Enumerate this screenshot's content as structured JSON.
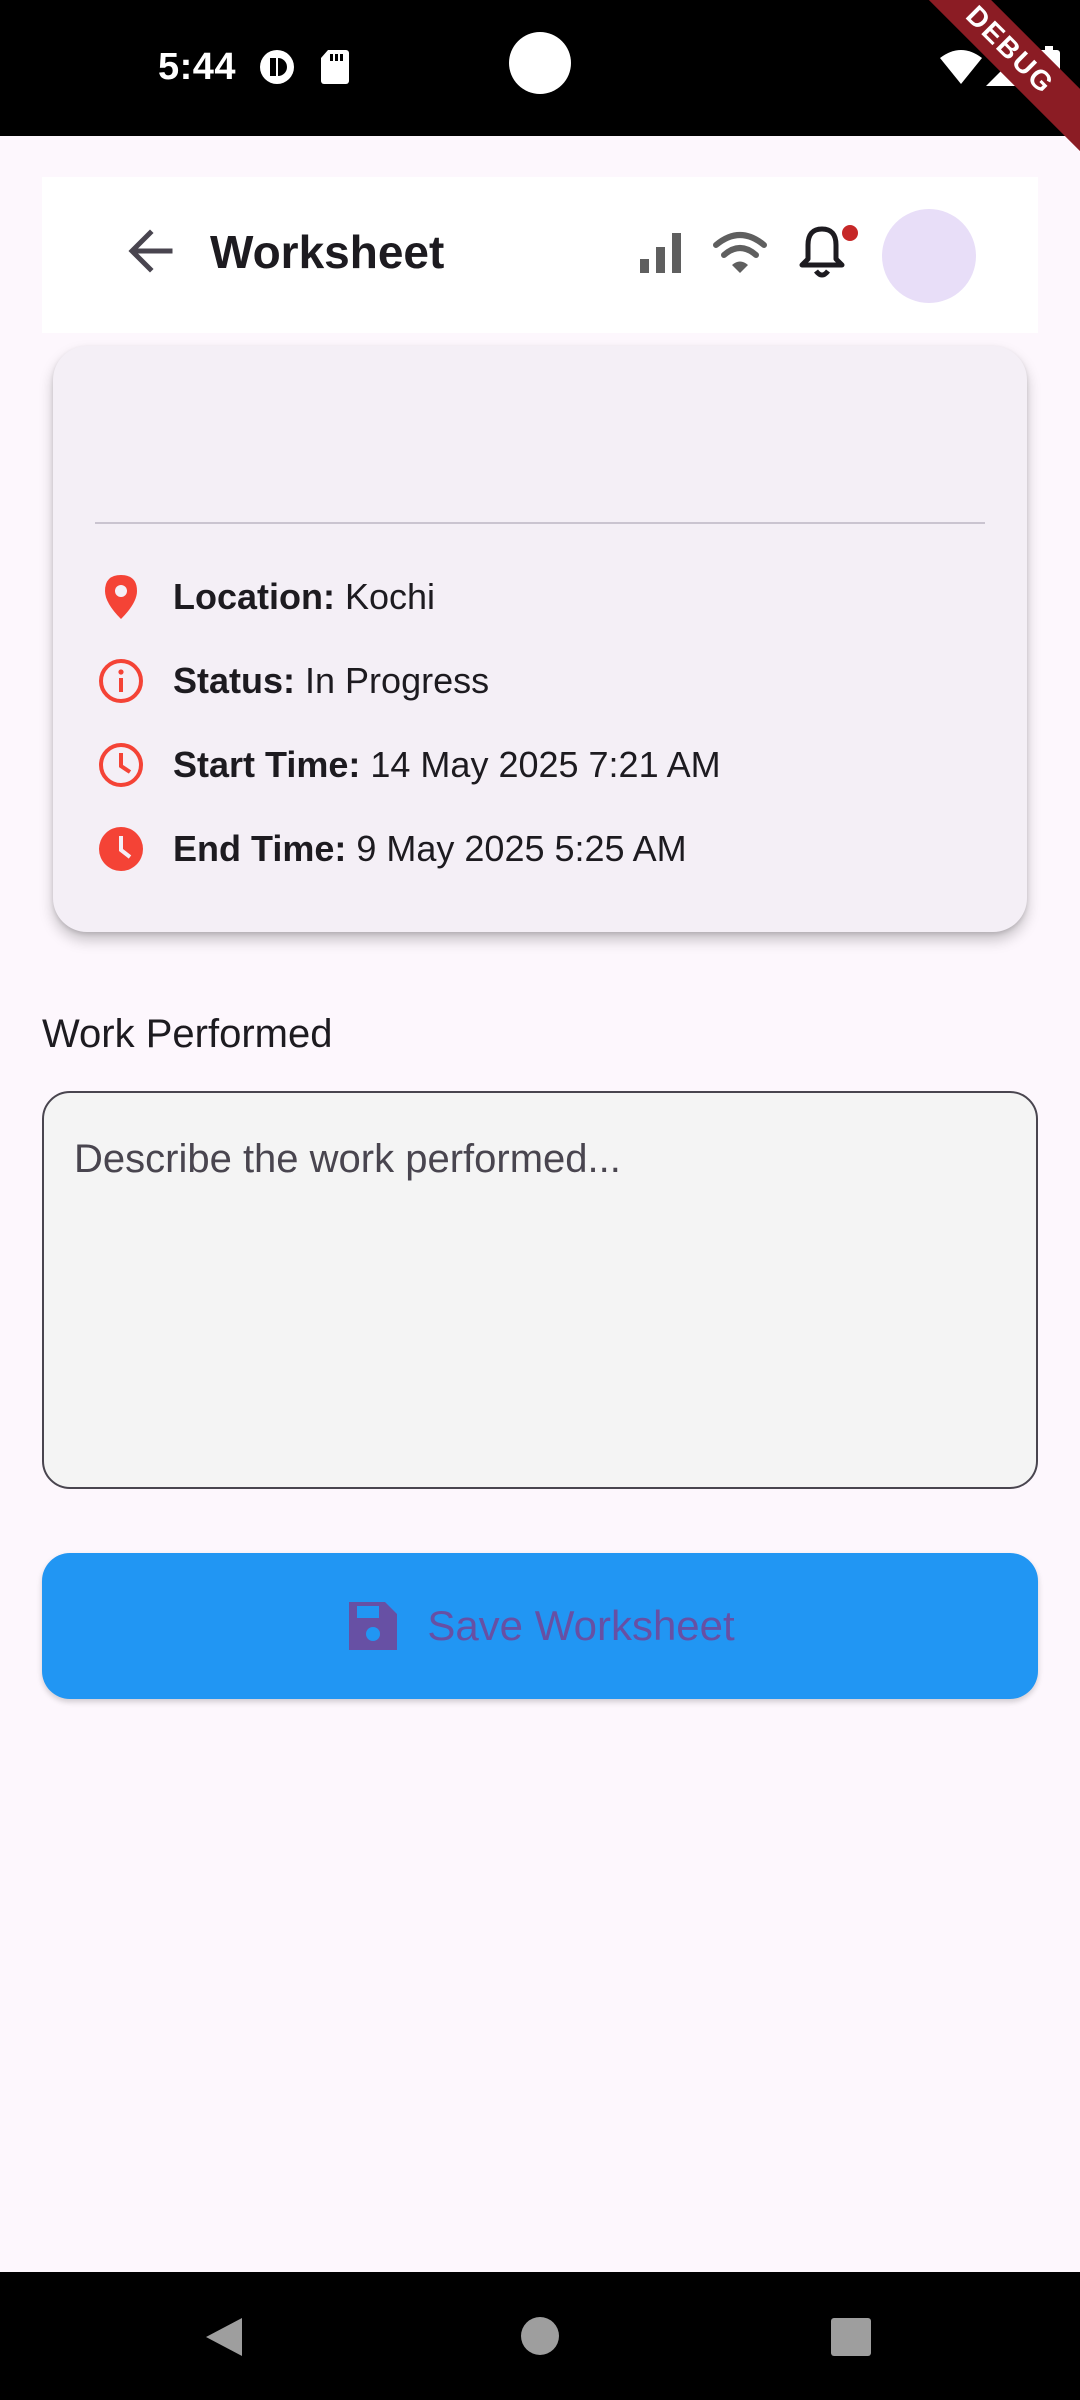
{
  "status_bar": {
    "time": "5:44",
    "debug_label": "DEBUG"
  },
  "app_bar": {
    "title": "Worksheet",
    "notification_dot_color": "#c62828",
    "avatar_color": "#e8def8"
  },
  "info_card": {
    "rows": [
      {
        "icon": "location-pin-icon",
        "label": "Location:",
        "value": "Kochi"
      },
      {
        "icon": "info-icon",
        "label": "Status:",
        "value": "In Progress"
      },
      {
        "icon": "clock-outline-icon",
        "label": "Start Time:",
        "value": "14 May 2025 7:21 AM"
      },
      {
        "icon": "clock-filled-icon",
        "label": "End Time:",
        "value": "9 May 2025 5:25 AM"
      }
    ],
    "icon_color": "#f44336"
  },
  "work_section": {
    "label": "Work Performed",
    "placeholder": "Describe the work performed...",
    "value": ""
  },
  "save_button": {
    "label": "Save Worksheet",
    "background": "#2196f3",
    "foreground": "#6750a4"
  }
}
